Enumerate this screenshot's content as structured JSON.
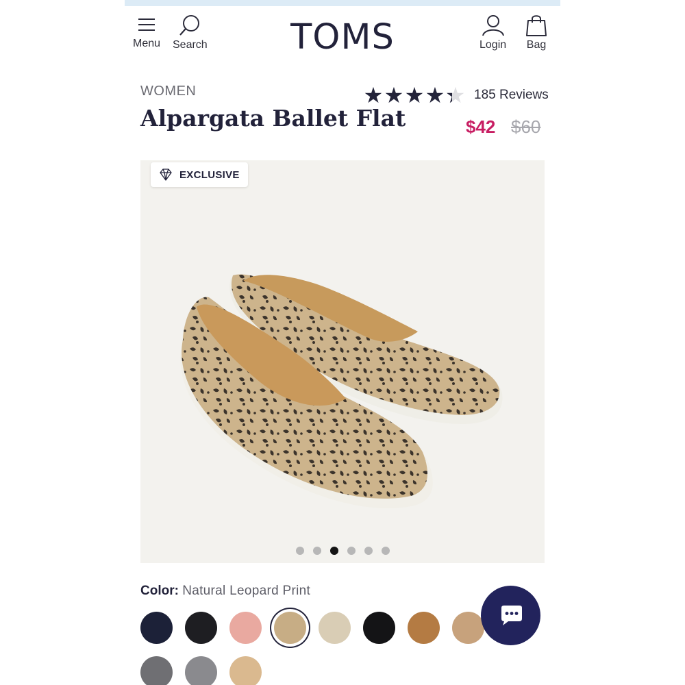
{
  "header": {
    "menu_label": "Menu",
    "search_label": "Search",
    "logo": "TOMS",
    "login_label": "Login",
    "bag_label": "Bag"
  },
  "product": {
    "category": "WOMEN",
    "name": "Alpargata Ballet Flat",
    "rating": 4.3,
    "rating_max": 5,
    "reviews": "185 Reviews",
    "price_now": "$42",
    "price_was": "$60",
    "badge": "EXCLUSIVE"
  },
  "gallery": {
    "image_count": 6,
    "active_index": 2
  },
  "color": {
    "label": "Color:",
    "value": "Natural Leopard Print",
    "swatches": [
      {
        "name": "navy",
        "color": "#1c2138"
      },
      {
        "name": "black-textured",
        "color": "#1e1e22"
      },
      {
        "name": "pink",
        "color": "#e9a9a0"
      },
      {
        "name": "natural-leopard-print",
        "color": "#c7ad85",
        "selected": true
      },
      {
        "name": "natural",
        "color": "#d9cdb5"
      },
      {
        "name": "black",
        "color": "#141416"
      },
      {
        "name": "leopard",
        "color": "#b47b43"
      },
      {
        "name": "tan",
        "color": "#c7a27c"
      },
      {
        "name": "grey-herringbone",
        "color": "#6f6f73"
      },
      {
        "name": "black-white-tweed",
        "color": "#8a8a8e"
      },
      {
        "name": "woven-natural",
        "color": "#dab98f"
      }
    ]
  },
  "colors": {
    "accent_price": "#c81e63",
    "brand_navy": "#22223a",
    "chat_bg": "#22235c"
  }
}
